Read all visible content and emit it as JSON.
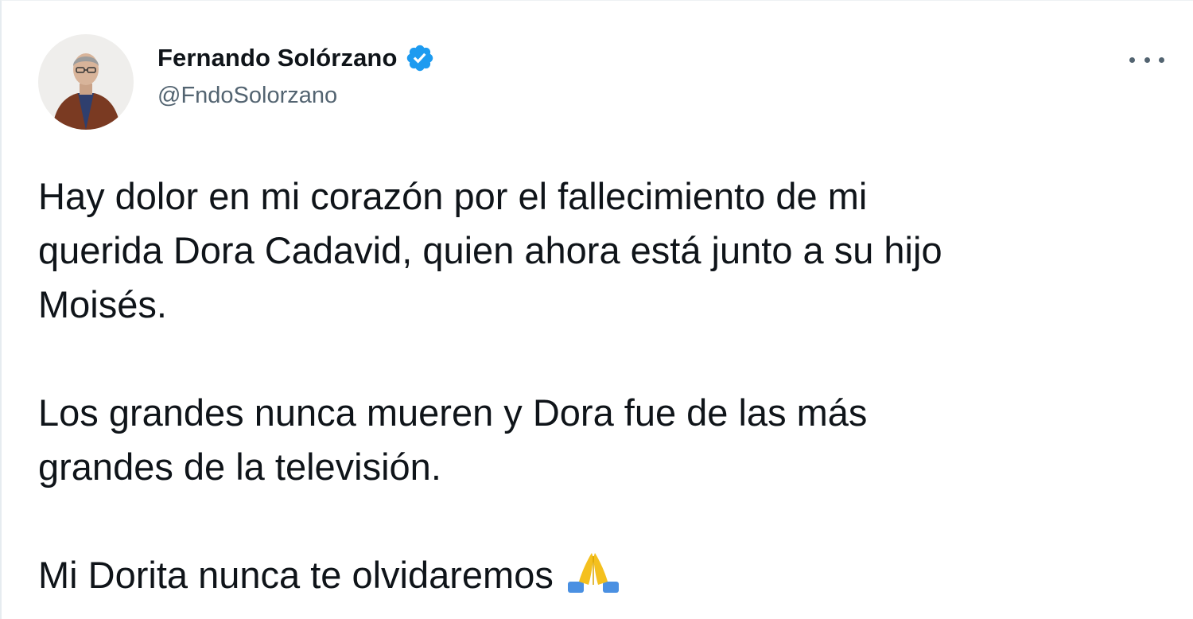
{
  "tweet": {
    "author": {
      "display_name": "Fernando Solórzano",
      "handle": "@FndoSolorzano",
      "verified": true,
      "verified_icon": "verified-badge-icon"
    },
    "more_icon": "more-horizontal-icon",
    "text_lines": {
      "p1_l1": "Hay dolor en mi corazón por el fallecimiento de mi",
      "p1_l2": "querida Dora Cadavid, quien ahora está junto a su hijo",
      "p1_l3": "Moisés.",
      "p2_l1": "Los grandes nunca mueren y Dora fue de las más",
      "p2_l2": "grandes de la televisión.",
      "p3_l1": "Mi Dorita nunca te olvidaremos"
    },
    "emoji": "folded-hands-icon",
    "colors": {
      "text": "#0f1419",
      "secondary": "#536471",
      "verified_blue": "#1d9bf0"
    }
  }
}
